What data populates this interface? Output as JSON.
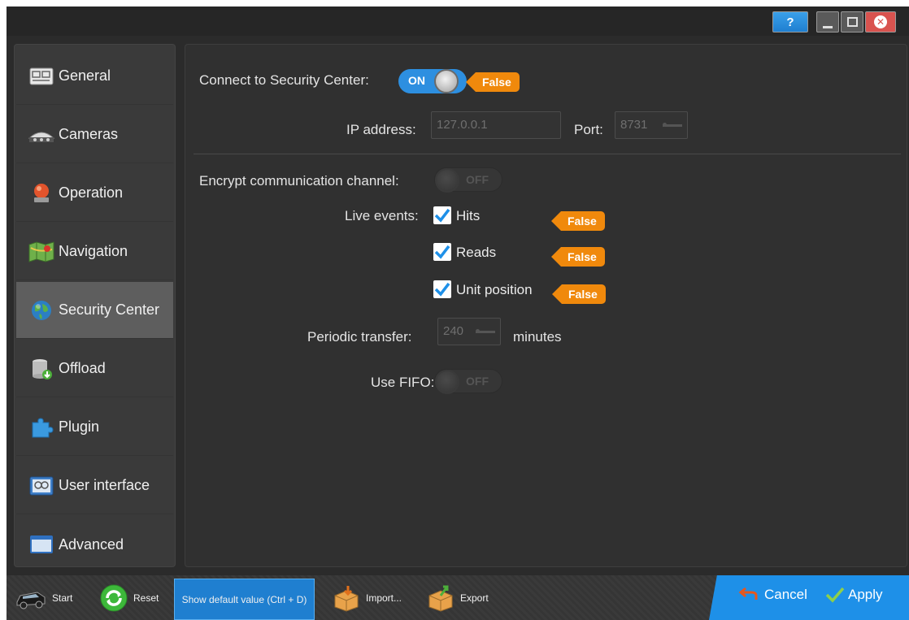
{
  "titlebar": {
    "help_label": "?"
  },
  "sidebar": {
    "items": [
      {
        "label": "General",
        "icon": "general-settings-icon"
      },
      {
        "label": "Cameras",
        "icon": "camera-icon"
      },
      {
        "label": "Operation",
        "icon": "siren-icon"
      },
      {
        "label": "Navigation",
        "icon": "map-icon"
      },
      {
        "label": "Security Center",
        "icon": "globe-icon",
        "selected": true
      },
      {
        "label": "Offload",
        "icon": "database-download-icon"
      },
      {
        "label": "Plugin",
        "icon": "puzzle-icon"
      },
      {
        "label": "User interface",
        "icon": "user-interface-icon"
      },
      {
        "label": "Advanced",
        "icon": "window-icon"
      }
    ]
  },
  "main": {
    "connect": {
      "label": "Connect to Security Center:",
      "toggle": "ON",
      "badge": "False"
    },
    "ip": {
      "label": "IP address:",
      "value": "127.0.0.1"
    },
    "port": {
      "label": "Port:",
      "value": "8731"
    },
    "encrypt": {
      "label": "Encrypt communication channel:",
      "toggle": "OFF"
    },
    "live_events": {
      "label": "Live events:",
      "options": [
        {
          "label": "Hits",
          "checked": true,
          "badge": "False"
        },
        {
          "label": "Reads",
          "checked": true,
          "badge": "False"
        },
        {
          "label": "Unit position",
          "checked": true,
          "badge": "False"
        }
      ]
    },
    "periodic": {
      "label": "Periodic transfer:",
      "value": "240",
      "unit": "minutes"
    },
    "fifo": {
      "label": "Use FIFO:",
      "toggle": "OFF"
    }
  },
  "bottom": {
    "start": "Start",
    "reset": "Reset",
    "default_value": "Show default value (Ctrl + D)",
    "import": "Import...",
    "export": "Export",
    "cancel": "Cancel",
    "apply": "Apply"
  },
  "colors": {
    "accent": "#1e90e8",
    "badge": "#f0890c",
    "selected": "#5e5e5e"
  }
}
